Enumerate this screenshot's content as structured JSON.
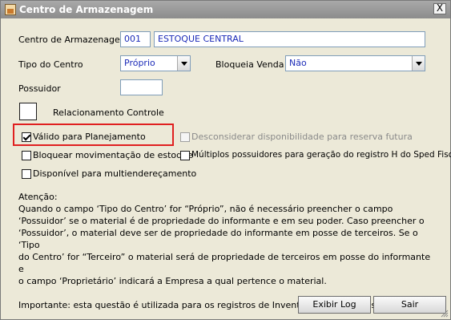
{
  "window": {
    "title": "Centro de Armazenagem",
    "close": "X"
  },
  "form": {
    "centro_label": "Centro de Armazenagem",
    "centro_code": "001",
    "centro_name": "ESTOQUE CENTRAL",
    "tipo_label": "Tipo do Centro",
    "tipo_value": "Próprio",
    "bloqueia_label": "Bloqueia Venda",
    "bloqueia_value": "Não",
    "possuidor_label": "Possuidor",
    "possuidor_value": "",
    "relacionamento_label": "Relacionamento Controle"
  },
  "checkboxes": {
    "valido": {
      "label": "Válido para Planejamento",
      "checked": true
    },
    "desconsiderar": {
      "label": "Desconsiderar disponibilidade para reserva futura",
      "checked": false,
      "disabled": true
    },
    "bloquear": {
      "label": "Bloquear movimentação de estoque",
      "checked": false
    },
    "multiplos": {
      "label": "Múltiplos possuidores para geração do registro H do Sped Fiscal",
      "checked": false
    },
    "disponivel": {
      "label": "Disponível para multiendereçamento",
      "checked": false
    }
  },
  "notes": {
    "line1": "Atenção:",
    "line2": "Quando o campo ‘Tipo do Centro’ for “Próprio”, não é necessário preencher o campo",
    "line3": "‘Possuidor’ se o material é de propriedade do informante e em seu poder. Caso preencher o",
    "line4": "‘Possuidor’, o material deve ser de propriedade do informante em posse de terceiros. Se o ‘Tipo",
    "line5": "do Centro’ for “Terceiro” o material será de propriedade de terceiros em posse do informante e",
    "line6": "o campo ‘Proprietário’ indicará a Empresa a qual pertence o material.",
    "line7": "Importante: esta questão é utilizada para os registros de Inventário dos arquivos legais."
  },
  "buttons": {
    "exibir_log": "Exibir Log",
    "sair": "Sair"
  },
  "colors": {
    "highlight": "#e02020",
    "value_text": "#1c2bb8"
  }
}
